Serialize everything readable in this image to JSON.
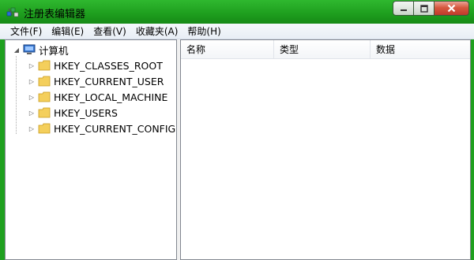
{
  "window": {
    "title": "注册表编辑器"
  },
  "menu": [
    {
      "label": "文件(F)"
    },
    {
      "label": "编辑(E)"
    },
    {
      "label": "查看(V)"
    },
    {
      "label": "收藏夹(A)"
    },
    {
      "label": "帮助(H)"
    }
  ],
  "tree": {
    "root": {
      "label": "计算机",
      "icon": "computer-icon",
      "expanded": true
    },
    "children": [
      {
        "label": "HKEY_CLASSES_ROOT",
        "icon": "folder-icon"
      },
      {
        "label": "HKEY_CURRENT_USER",
        "icon": "folder-icon"
      },
      {
        "label": "HKEY_LOCAL_MACHINE",
        "icon": "folder-icon"
      },
      {
        "label": "HKEY_USERS",
        "icon": "folder-icon"
      },
      {
        "label": "HKEY_CURRENT_CONFIG",
        "icon": "folder-icon"
      }
    ]
  },
  "list": {
    "columns": [
      {
        "label": "名称"
      },
      {
        "label": "类型"
      },
      {
        "label": "数据"
      }
    ]
  },
  "colors": {
    "title_bar": "#1fa01f",
    "close_button": "#c0392b"
  }
}
